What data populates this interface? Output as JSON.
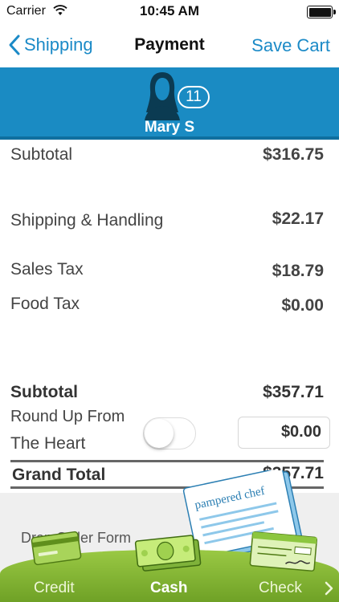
{
  "status_bar": {
    "carrier": "Carrier",
    "time": "10:45 AM"
  },
  "nav": {
    "back_label": "Shipping",
    "title": "Payment",
    "action_label": "Save Cart"
  },
  "host": {
    "name": "Mary S",
    "badge_count": "11"
  },
  "summary": {
    "subtotal_label": "Subtotal",
    "subtotal_value": "$316.75",
    "shipping_label": "Shipping & Handling",
    "shipping_value": "$22.17",
    "sales_tax_label": "Sales Tax",
    "sales_tax_value": "$18.79",
    "food_tax_label": "Food Tax",
    "food_tax_value": "$0.00",
    "subtotal2_label": "Subtotal",
    "subtotal2_value": "$357.71",
    "roundup_label_line1": "Round Up From",
    "roundup_label_line2": "The Heart",
    "roundup_value": "$0.00",
    "roundup_enabled": false,
    "grand_total_label": "Grand Total",
    "grand_total_value": "$357.71"
  },
  "footer": {
    "drop_order_text": "Drop Order Form",
    "brand_text": "pampered chef",
    "payment_methods": [
      "Credit",
      "Cash",
      "Check"
    ],
    "active_method": "Cash"
  },
  "colors": {
    "accent": "#1b8ac7",
    "banner": "#1a8bc3",
    "green": "#8cc63f"
  }
}
